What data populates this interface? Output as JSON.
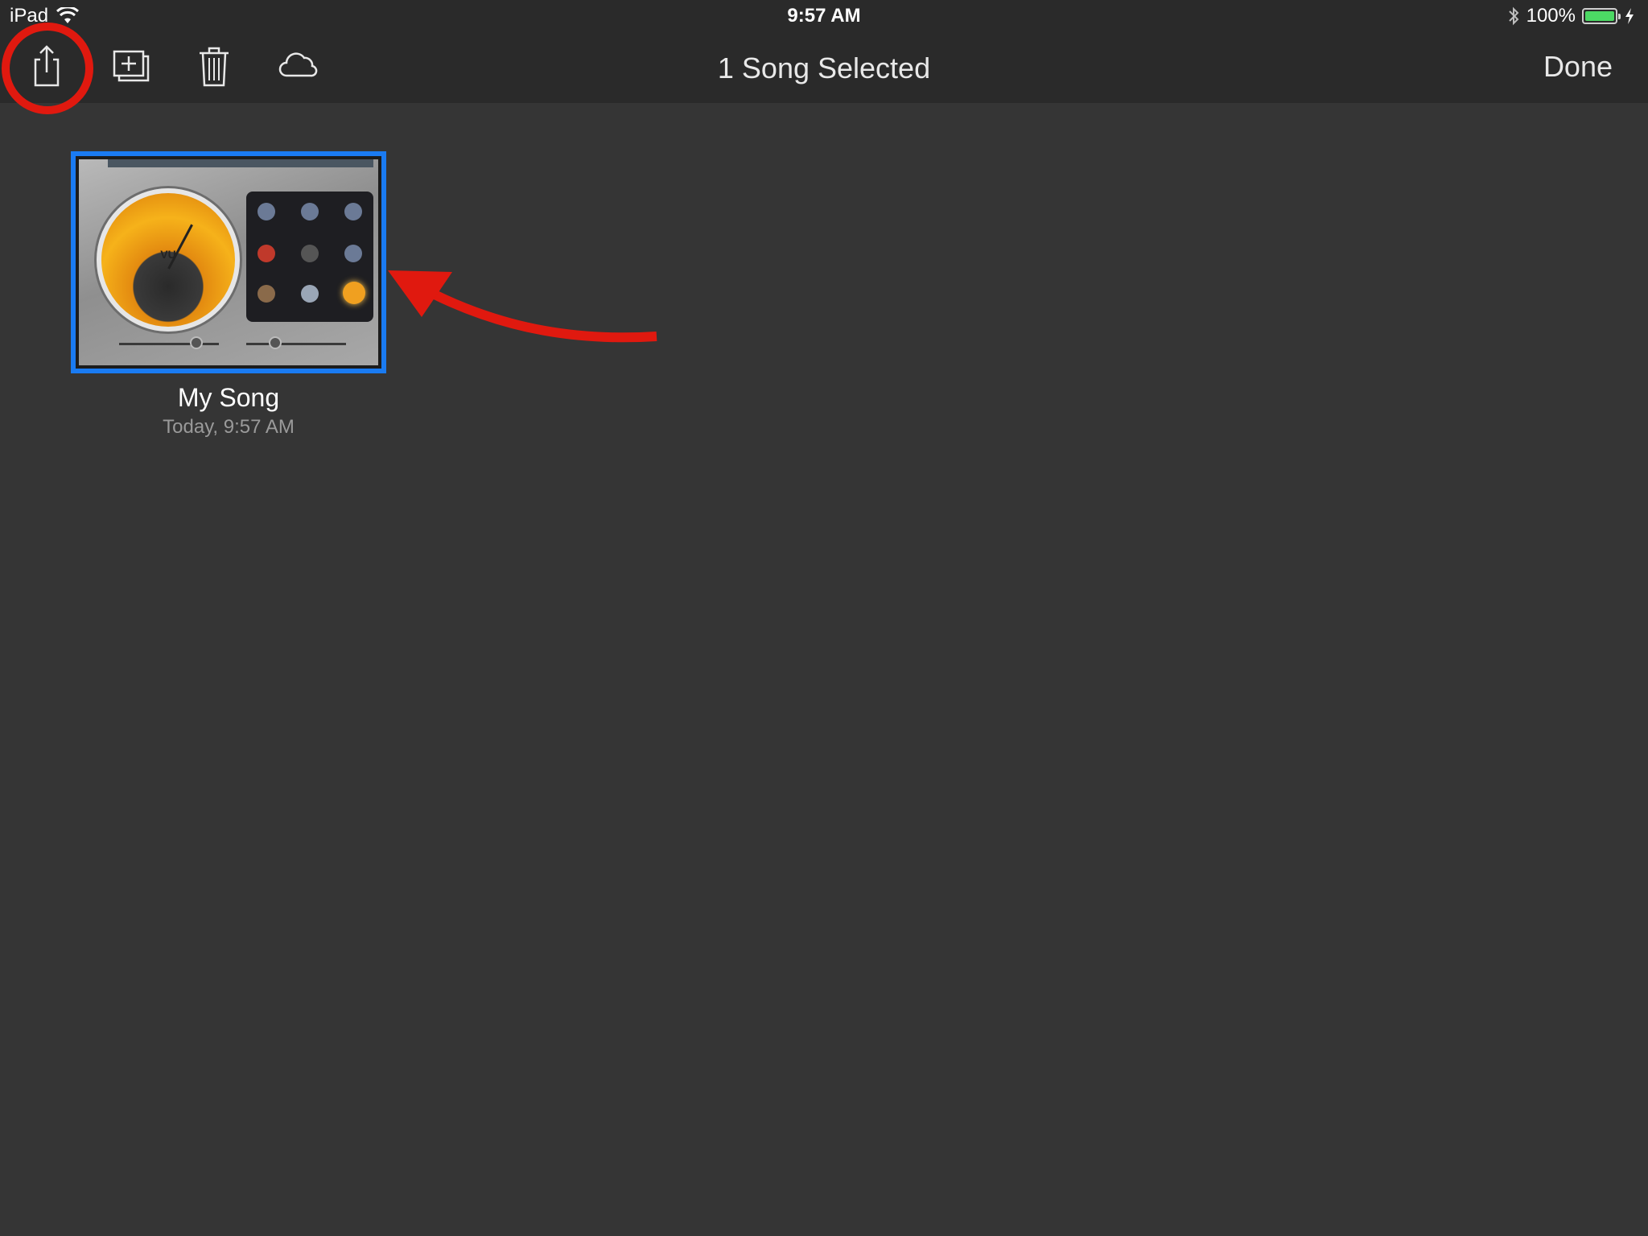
{
  "status_bar": {
    "device": "iPad",
    "time": "9:57 AM",
    "battery_percent": "100%",
    "battery_level": 1.0
  },
  "toolbar": {
    "title": "1 Song Selected",
    "done_label": "Done",
    "icons": [
      "share-icon",
      "duplicate-icon",
      "trash-icon",
      "icloud-icon"
    ]
  },
  "songs": [
    {
      "name": "My Song",
      "date": "Today, 9:57 AM",
      "selected": true
    }
  ],
  "thumbnail": {
    "meter_label": "VU"
  },
  "colors": {
    "background": "#353535",
    "bar": "#2a2a2a",
    "selection": "#1a7bf2",
    "annotation": "#e0190f",
    "battery": "#4cd964"
  }
}
